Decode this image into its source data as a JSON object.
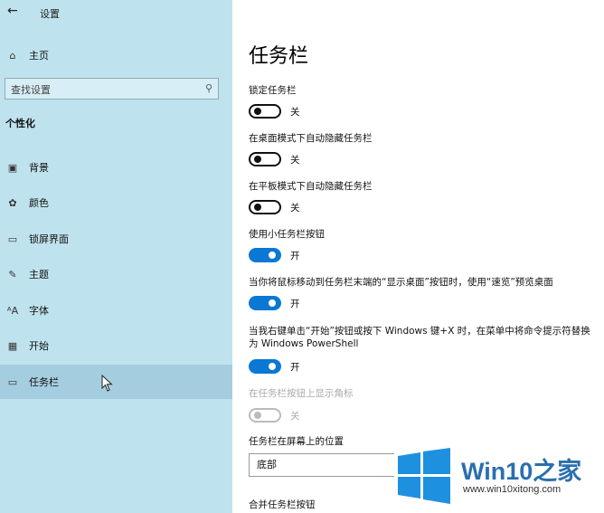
{
  "header": {
    "back_icon": "←",
    "title": "设置"
  },
  "sidebar": {
    "home_label": "主页",
    "search_placeholder": "查找设置",
    "section_heading": "个性化",
    "items": [
      {
        "label": "背景",
        "icon": "image-icon",
        "glyph": "▣"
      },
      {
        "label": "颜色",
        "icon": "palette-icon",
        "glyph": "✿"
      },
      {
        "label": "锁屏界面",
        "icon": "lock-screen-icon",
        "glyph": "▭"
      },
      {
        "label": "主题",
        "icon": "theme-icon",
        "glyph": "✎"
      },
      {
        "label": "字体",
        "icon": "font-icon",
        "glyph": "ᴬA"
      },
      {
        "label": "开始",
        "icon": "start-icon",
        "glyph": "▦"
      },
      {
        "label": "任务栏",
        "icon": "taskbar-icon",
        "glyph": "▭",
        "active": true
      }
    ]
  },
  "main": {
    "title": "任务栏",
    "settings": [
      {
        "label": "锁定任务栏",
        "state": "关",
        "on": false
      },
      {
        "label": "在桌面模式下自动隐藏任务栏",
        "state": "关",
        "on": false
      },
      {
        "label": "在平板模式下自动隐藏任务栏",
        "state": "关",
        "on": false
      },
      {
        "label": "使用小任务栏按钮",
        "state": "开",
        "on": true
      },
      {
        "label": "当你将鼠标移动到任务栏末端的“显示桌面”按钮时，使用“速览”预览桌面",
        "state": "开",
        "on": true
      },
      {
        "label": "当我右键单击“开始”按钮或按下 Windows 键+X 时，在菜单中将命令提示符替换为 Windows PowerShell",
        "state": "开",
        "on": true
      },
      {
        "label": "在任务栏按钮上显示角标",
        "state": "关",
        "on": false,
        "disabled": true
      }
    ],
    "position_label": "任务栏在屏幕上的位置",
    "position_value": "底部",
    "combine_label": "合并任务栏按钮"
  },
  "watermark": {
    "brand": "Win10",
    "brand_zh": "之家",
    "url": "www.win10xitong.com"
  },
  "colors": {
    "sidebar_bg": "#bfe3ee",
    "active_item_bg": "#a5cde0",
    "toggle_on": "#0a78d4",
    "watermark_blue": "#2a6fb0"
  }
}
